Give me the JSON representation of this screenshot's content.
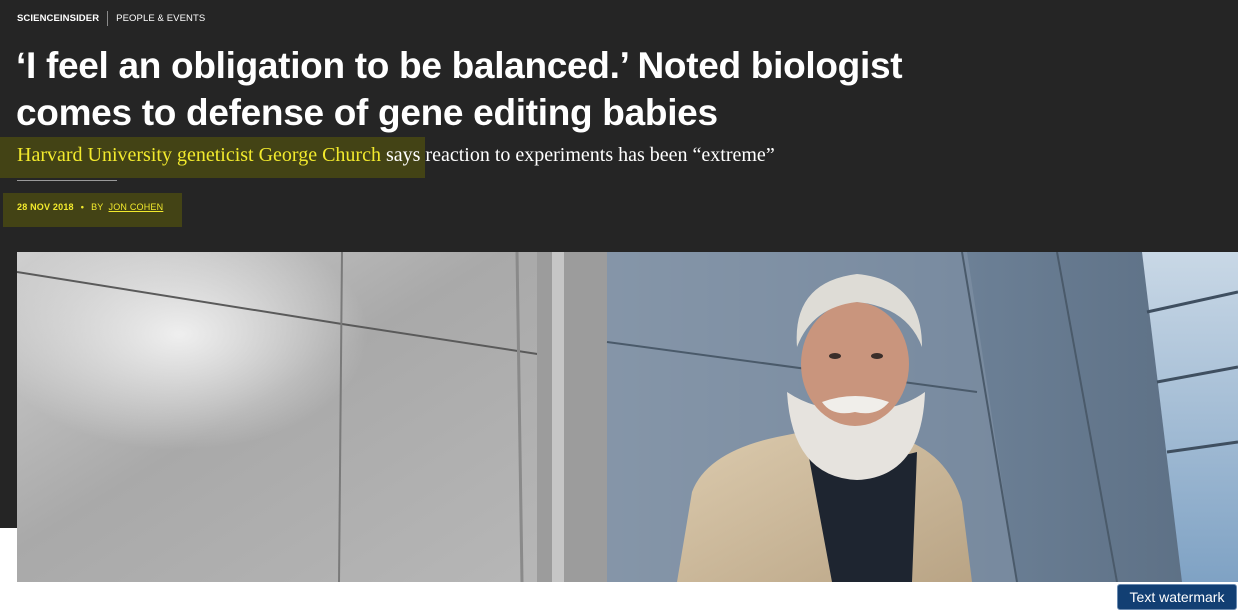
{
  "kicker": {
    "brand": "SCIENCEINSIDER",
    "section": "PEOPLE & EVENTS"
  },
  "article": {
    "headline": "‘I feel an obligation to be balanced.’ Noted biologist comes to defense of gene editing babies",
    "dek_highlight": "Harvard University geneticist George Church",
    "dek_rest": " says reaction to experiments has been “extreme”",
    "date": "28 NOV 2018",
    "separator": "•",
    "by_label": "BY",
    "author": "JON COHEN"
  },
  "hero_image": {
    "subject": "photo-portrait-of-bearded-man-in-front-of-metal-facade"
  },
  "watermark": {
    "label": "Text watermark"
  },
  "colors": {
    "background": "#252525",
    "highlight_text": "#f2ea2d",
    "watermark_bg": "#123f73"
  }
}
